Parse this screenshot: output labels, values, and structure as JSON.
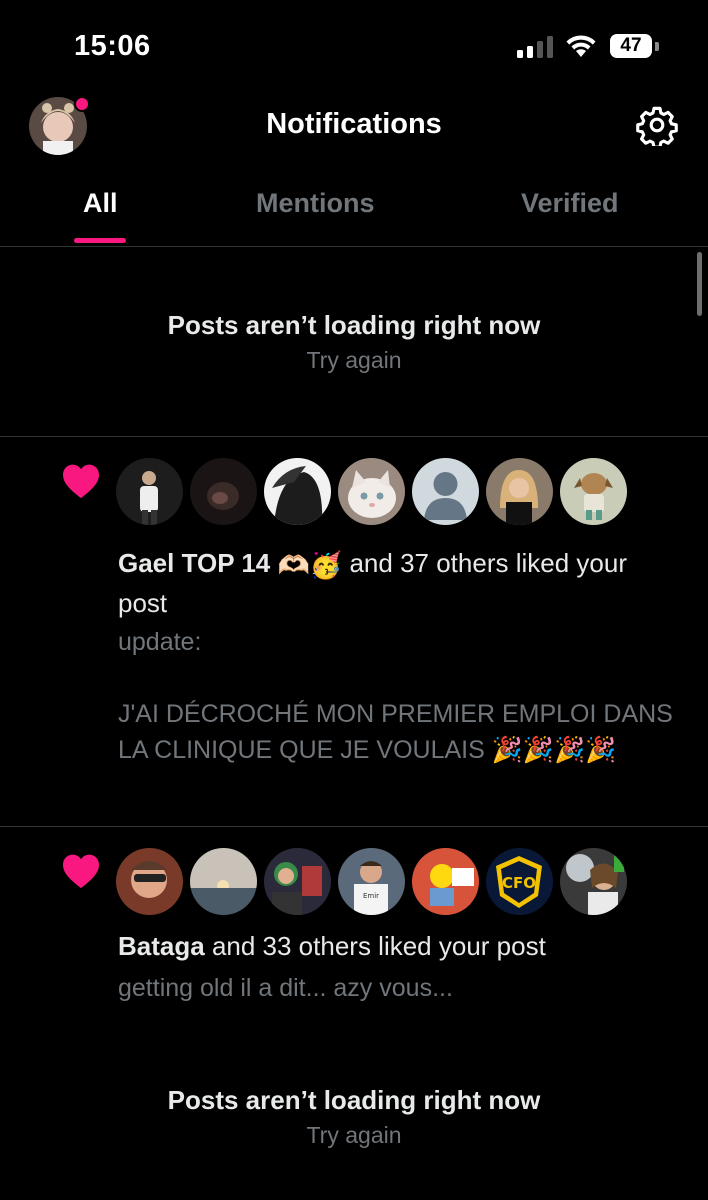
{
  "status_bar": {
    "time": "15:06",
    "battery": "47"
  },
  "header": {
    "title": "Notifications"
  },
  "tabs": [
    {
      "label": "All",
      "active": true
    },
    {
      "label": "Mentions",
      "active": false
    },
    {
      "label": "Verified",
      "active": false
    }
  ],
  "errors": [
    {
      "title": "Posts aren’t loading right now",
      "retry": "Try again"
    },
    {
      "title": "Posts aren’t loading right now",
      "retry": "Try again"
    }
  ],
  "notifications": [
    {
      "type": "like",
      "icon": "heart-icon",
      "user": "Gael TOP 14",
      "user_emojis": "🫶🏻🥳",
      "action": "and 37 others liked your post",
      "post_lines": [
        "update:",
        "",
        "J'AI DÉCROCHÉ MON PREMIER EMPLOI DANS LA CLINIQUE QUE JE VOULAIS 🎉🎉🎉🎉"
      ]
    },
    {
      "type": "like",
      "icon": "heart-icon",
      "user": "Bataga",
      "action": "and 33 others liked your post",
      "post_lines": [
        "getting old il a dit... azy vous..."
      ]
    }
  ],
  "colors": {
    "accent": "#f91880",
    "background": "#000000",
    "muted": "#71767b",
    "text": "#e7e9ea"
  }
}
